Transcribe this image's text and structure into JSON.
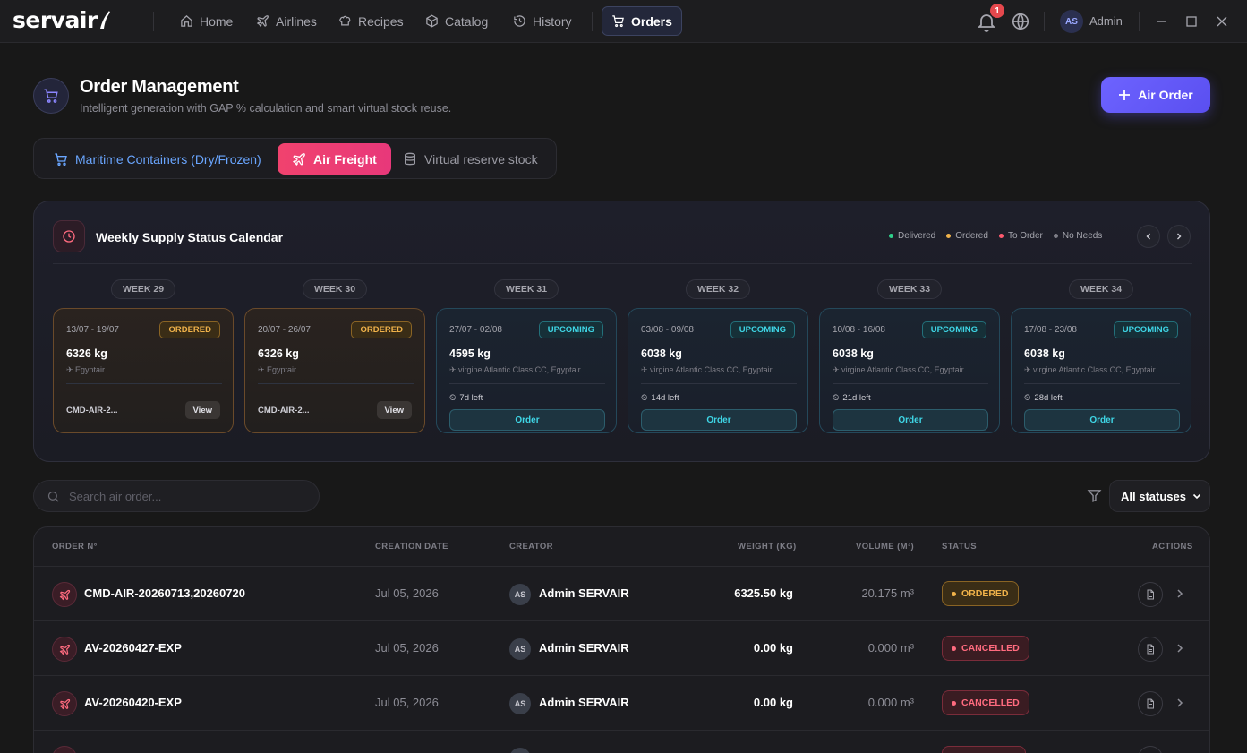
{
  "app": {
    "logo_text": "servair"
  },
  "nav": {
    "items": [
      {
        "label": "Home",
        "icon": "home-icon"
      },
      {
        "label": "Airlines",
        "icon": "plane-icon"
      },
      {
        "label": "Recipes",
        "icon": "chef-hat-icon"
      },
      {
        "label": "Catalog",
        "icon": "box-icon"
      },
      {
        "label": "History",
        "icon": "history-icon"
      },
      {
        "label": "Orders",
        "icon": "cart-icon",
        "active": true
      }
    ],
    "notifications_count": "1",
    "user_initials": "AS",
    "user_name": "Admin"
  },
  "page": {
    "title": "Order Management",
    "subtitle": "Intelligent generation with GAP % calculation and smart virtual stock reuse.",
    "primary_button": "Air Order",
    "primary_icon": "plus-icon"
  },
  "mode_tabs": [
    {
      "label": "Maritime Containers (Dry/Frozen)",
      "icon": "cart-icon"
    },
    {
      "label": "Air Freight",
      "icon": "plane-icon",
      "active": true
    },
    {
      "label": "Virtual reserve stock",
      "icon": "database-icon"
    }
  ],
  "calendar": {
    "title": "Weekly Supply Status Calendar",
    "legend": [
      {
        "label": "Delivered",
        "color": "#2fd08a"
      },
      {
        "label": "Ordered",
        "color": "#f0b24a"
      },
      {
        "label": "To Order",
        "color": "#ff5a6e"
      },
      {
        "label": "No Needs",
        "color": "#7d7d86"
      }
    ],
    "weeks": [
      {
        "week": "WEEK 29",
        "range": "13/07 - 19/07",
        "status": "ORDERED",
        "weight": "6326 kg",
        "airlines": "✈ Egyptair",
        "ref": "CMD-AIR-2...",
        "action": "View"
      },
      {
        "week": "WEEK 30",
        "range": "20/07 - 26/07",
        "status": "ORDERED",
        "weight": "6326 kg",
        "airlines": "✈ Egyptair",
        "ref": "CMD-AIR-2...",
        "action": "View"
      },
      {
        "week": "WEEK 31",
        "range": "27/07 - 02/08",
        "status": "UPCOMING",
        "weight": "4595 kg",
        "airlines": "✈ virgine Atlantic Class CC, Egyptair",
        "time_left": "7d left",
        "action": "Order"
      },
      {
        "week": "WEEK 32",
        "range": "03/08 - 09/08",
        "status": "UPCOMING",
        "weight": "6038 kg",
        "airlines": "✈ virgine Atlantic Class CC, Egyptair",
        "time_left": "14d left",
        "action": "Order"
      },
      {
        "week": "WEEK 33",
        "range": "10/08 - 16/08",
        "status": "UPCOMING",
        "weight": "6038 kg",
        "airlines": "✈ virgine Atlantic Class CC, Egyptair",
        "time_left": "21d left",
        "action": "Order"
      },
      {
        "week": "WEEK 34",
        "range": "17/08 - 23/08",
        "status": "UPCOMING",
        "weight": "6038 kg",
        "airlines": "✈ virgine Atlantic Class CC, Egyptair",
        "time_left": "28d left",
        "action": "Order"
      }
    ]
  },
  "filters": {
    "search_placeholder": "Search air order...",
    "status_select": "All statuses"
  },
  "table": {
    "columns": [
      "ORDER N°",
      "CREATION DATE",
      "CREATOR",
      "WEIGHT (KG)",
      "VOLUME (M³)",
      "STATUS",
      "ACTIONS"
    ],
    "rows": [
      {
        "order": "CMD-AIR-20260713,20260720",
        "date": "Jul 05, 2026",
        "creator_initials": "AS",
        "creator": "Admin SERVAIR",
        "weight": "6325.50 kg",
        "volume": "20.175 m³",
        "status": "ORDERED"
      },
      {
        "order": "AV-20260427-EXP",
        "date": "Jul 05, 2026",
        "creator_initials": "AS",
        "creator": "Admin SERVAIR",
        "weight": "0.00 kg",
        "volume": "0.000 m³",
        "status": "CANCELLED"
      },
      {
        "order": "AV-20260420-EXP",
        "date": "Jul 05, 2026",
        "creator_initials": "AS",
        "creator": "Admin SERVAIR",
        "weight": "0.00 kg",
        "volume": "0.000 m³",
        "status": "CANCELLED"
      }
    ]
  }
}
